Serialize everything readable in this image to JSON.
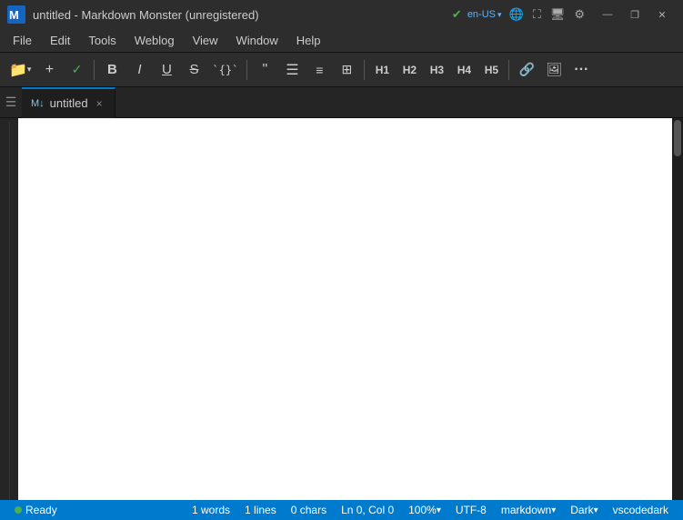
{
  "titlebar": {
    "title": "untitled  -  Markdown Monster (unregistered)",
    "logo_symbol": "M",
    "lang": "en-US",
    "minimize_label": "—",
    "restore_label": "❐",
    "close_label": "✕"
  },
  "menubar": {
    "items": [
      "File",
      "Edit",
      "Tools",
      "Weblog",
      "View",
      "Window",
      "Help"
    ]
  },
  "toolbar": {
    "folder_label": "🗁",
    "plus_label": "+",
    "check_label": "✓",
    "bold_label": "B",
    "italic_label": "I",
    "underline_label": "U",
    "strikethrough_label": "S",
    "code_label": "{}` ",
    "quote_label": "❝",
    "ul_label": "≡",
    "ol_label": "≡",
    "table_label": "▦",
    "h1_label": "H1",
    "h2_label": "H2",
    "h3_label": "H3",
    "h4_label": "H4",
    "h5_label": "H5",
    "link_label": "🔗",
    "image_label": "🖼",
    "more_label": "⋯"
  },
  "tabbar": {
    "tab_icon": "M↓",
    "tab_label": "untitled",
    "tab_close": "×"
  },
  "editor": {
    "content": "",
    "placeholder": ""
  },
  "statusbar": {
    "ready_label": "Ready",
    "words": "1 words",
    "lines": "1 lines",
    "chars": "0 chars",
    "position": "Ln 0, Col 0",
    "zoom": "100%",
    "encoding": "UTF-8",
    "syntax": "markdown",
    "theme": "Dark",
    "vscodedark": "vscodedark"
  }
}
